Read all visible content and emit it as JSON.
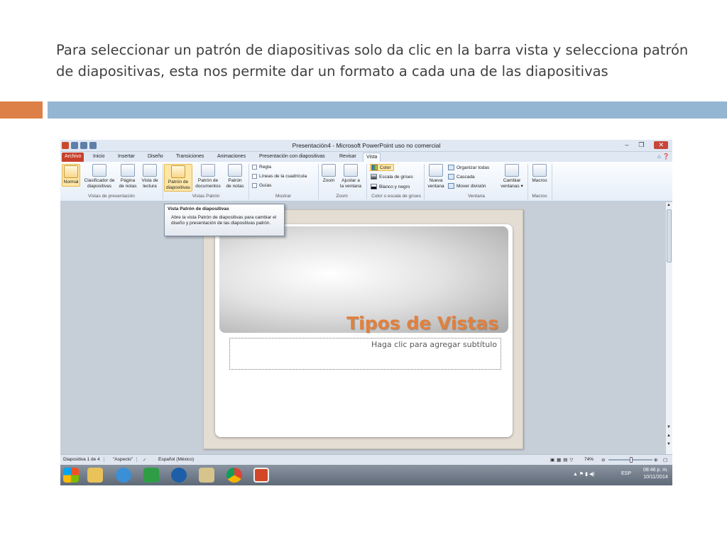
{
  "slide_heading": "Para seleccionar un patrón de diapositivas solo da clic en la barra vista y selecciona patrón de diapositivas, esta nos permite dar un formato a cada una de las diapositivas",
  "window": {
    "title": "Presentación4  -  Microsoft PowerPoint uso no comercial"
  },
  "tabs": [
    {
      "label": "Archivo"
    },
    {
      "label": "Inicio"
    },
    {
      "label": "Insertar"
    },
    {
      "label": "Diseño"
    },
    {
      "label": "Transiciones"
    },
    {
      "label": "Animaciones"
    },
    {
      "label": "Presentación con diapositivas"
    },
    {
      "label": "Revisar"
    },
    {
      "label": "Vista"
    }
  ],
  "ribbon": {
    "groups": {
      "vistas_presentacion": {
        "label": "Vistas de presentación",
        "normal": "Normal",
        "clasificador": [
          "Clasificador de",
          "diapositivas"
        ],
        "pagina_notas": [
          "Página",
          "de notas"
        ],
        "vista_lectura": [
          "Vista de",
          "lectura"
        ]
      },
      "vistas_patron": {
        "label": "Vistas Patrón",
        "patron_diapositivas": [
          "Patrón de",
          "diapositivas"
        ],
        "patron_documentos": [
          "Patrón de",
          "documentos"
        ],
        "patron_notas": [
          "Patrón",
          "de notas"
        ]
      },
      "mostrar": {
        "label": "Mostrar",
        "regla": "Regla",
        "lineas": "Líneas de la cuadrícula",
        "guias": "Guías"
      },
      "zoom": {
        "label": "Zoom",
        "zoom": "Zoom",
        "ajustar": [
          "Ajustar a",
          "la ventana"
        ]
      },
      "color": {
        "label": "Color o escala de grises",
        "color": "Color",
        "grises": "Escala de grises",
        "blanco_negro": "Blanco y negro"
      },
      "ventana": {
        "label": "Ventana",
        "nueva": [
          "Nueva",
          "ventana"
        ],
        "organizar": "Organizar todas",
        "cascada": "Cascada",
        "mover": "Mover división",
        "cambiar": [
          "Cambiar",
          "ventanas ▾"
        ]
      },
      "macros": {
        "label": "Macros",
        "macros": "Macros"
      }
    }
  },
  "tooltip": {
    "title": "Vista Patrón de diapositivas",
    "description": "Abre la vista Patrón de diapositivas para cambiar el diseño y presentación de las diapositivas patrón."
  },
  "slide": {
    "title": "Tipos de Vistas",
    "subtitle_placeholder": "Haga clic para agregar subtítulo"
  },
  "status_bar": {
    "slide_count": "Diapositiva 1 de 4",
    "theme": "\"Aspecto\"",
    "language": "Español (México)",
    "zoom": "74%"
  },
  "taskbar": {
    "language": "ESP",
    "time": "08:46 p. m.",
    "date": "10/11/2014"
  },
  "colors": {
    "accent_orange": "#dd8047",
    "accent_blue": "#94b6d2",
    "slide_title": "#e0813f",
    "file_tab": "#c8402b"
  }
}
